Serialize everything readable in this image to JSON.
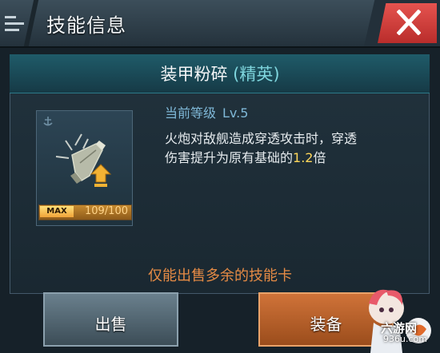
{
  "header": {
    "title": "技能信息"
  },
  "skill": {
    "name": "装甲粉碎",
    "tier": "(精英)",
    "level_label": "当前等级",
    "level_value": "Lv.5",
    "desc_line1": "火炮对敌舰造成穿透攻击时，穿透",
    "desc_line2_pre": "伤害提升为原有基础的",
    "desc_multiplier": "1.2",
    "desc_line2_post": "倍"
  },
  "card": {
    "max_badge": "MAX",
    "exp_text": "109/100",
    "exp_fraction": 1.0
  },
  "note": "仅能出售多余的技能卡",
  "buttons": {
    "sell": "出售",
    "equip": "装备"
  },
  "watermark": {
    "logo": "六游网",
    "url": "936u.com"
  },
  "icons": [
    "menu-icon",
    "close-icon",
    "anchor-icon",
    "shell-icon",
    "level-up-arrow-icon"
  ]
}
